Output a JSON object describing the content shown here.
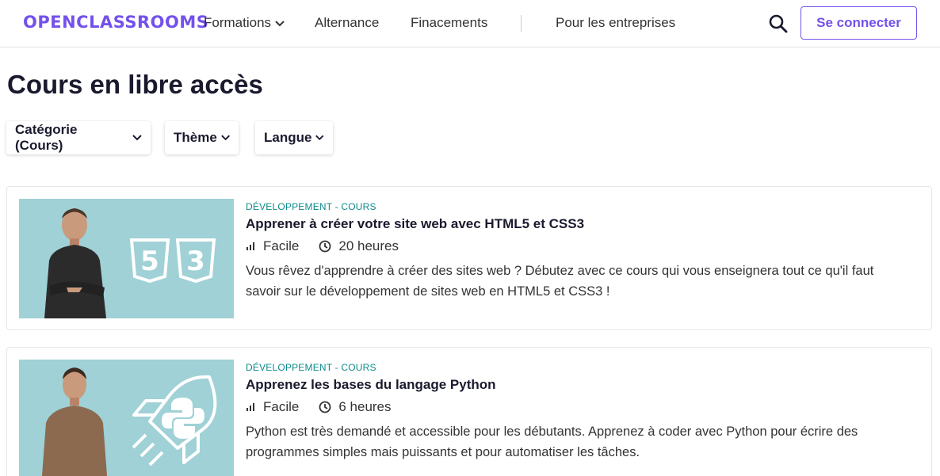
{
  "header": {
    "logo": "OPENCLASSROOMS",
    "nav": {
      "formations": "Formations",
      "alternance": "Alternance",
      "financements": "Finacements",
      "entreprises": "Pour les entreprises"
    },
    "login_label": "Se connecter",
    "accent_color": "#7451eb"
  },
  "page": {
    "title": "Cours en libre accès"
  },
  "filters": {
    "category": "Catégorie (Cours)",
    "theme": "Thème",
    "language": "Langue"
  },
  "courses": [
    {
      "meta": "DÉVELOPPEMENT - COURS",
      "title": "Apprener à créer votre site web avec HTML5 et CSS3",
      "level": "Facile",
      "duration": "20 heures",
      "description": "Vous rêvez d'apprendre à créer des sites web ? Débutez avec ce cours qui vous enseignera tout ce qu'il faut savoir sur le développement de sites web en HTML5 et CSS3 !",
      "thumbnail_icons": [
        "html5-icon",
        "css3-icon"
      ]
    },
    {
      "meta": "DÉVELOPPEMENT - COURS",
      "title": "Apprenez les bases du langage Python",
      "level": "Facile",
      "duration": "6 heures",
      "description": "Python est très demandé et accessible pour les débutants. Apprenez à coder avec Python pour écrire des programmes simples mais puissants et pour automatiser les tâches.",
      "thumbnail_icons": [
        "rocket-icon",
        "python-icon"
      ]
    }
  ]
}
